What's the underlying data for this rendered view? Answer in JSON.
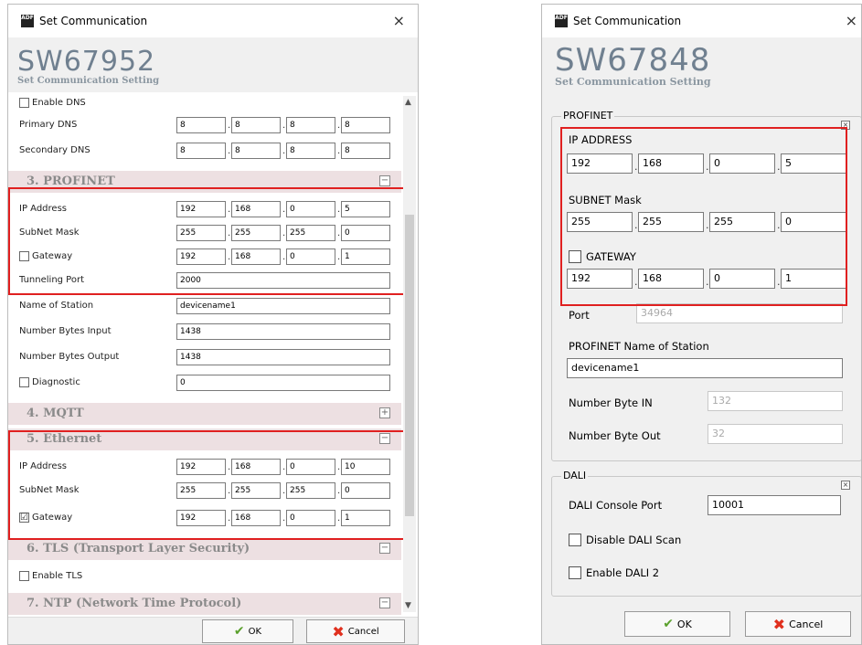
{
  "left": {
    "title": "Set Communication",
    "close": "×",
    "product": "SW67952",
    "subtitle": "Set Communication Setting",
    "dns": {
      "enable_label": "Enable DNS",
      "primary_label": "Primary DNS",
      "primary": [
        "8",
        "8",
        "8",
        "8"
      ],
      "secondary_label": "Secondary DNS",
      "secondary": [
        "8",
        "8",
        "8",
        "8"
      ]
    },
    "profinet": {
      "header": "3. PROFINET",
      "toggle": "⊟",
      "ip_label": "IP Address",
      "ip": [
        "192",
        "168",
        "0",
        "5"
      ],
      "mask_label": "SubNet Mask",
      "mask": [
        "255",
        "255",
        "255",
        "0"
      ],
      "gw_label": "Gateway",
      "gw": [
        "192",
        "168",
        "0",
        "1"
      ],
      "tunnel_label": "Tunneling Port",
      "tunnel": "2000",
      "station_label": "Name of Station",
      "station": "devicename1",
      "bin_label": "Number Bytes Input",
      "bin": "1438",
      "bout_label": "Number Bytes Output",
      "bout": "1438",
      "diag_label": "Diagnostic",
      "diag": "0"
    },
    "mqtt": {
      "header": "4. MQTT",
      "toggle": "⊞"
    },
    "ethernet": {
      "header": "5. Ethernet",
      "toggle": "⊟",
      "ip_label": "IP Address",
      "ip": [
        "192",
        "168",
        "0",
        "10"
      ],
      "mask_label": "SubNet Mask",
      "mask": [
        "255",
        "255",
        "255",
        "0"
      ],
      "gw_label": "Gateway",
      "gw_checked": "☑",
      "gw": [
        "192",
        "168",
        "0",
        "1"
      ]
    },
    "tls": {
      "header": "6. TLS (Transport Layer Security)",
      "toggle": "⊟",
      "enable_label": "Enable TLS"
    },
    "ntp": {
      "header": "7. NTP (Network Time Protocol)",
      "toggle": "⊟"
    },
    "ok": "OK",
    "cancel": "Cancel"
  },
  "right": {
    "title": "Set Communication",
    "close": "×",
    "product": "SW67848",
    "subtitle": "Set Communication Setting",
    "profinet": {
      "legend": "PROFINET",
      "ip_label": "IP ADDRESS",
      "ip": [
        "192",
        "168",
        "0",
        "5"
      ],
      "mask_label": "SUBNET Mask",
      "mask": [
        "255",
        "255",
        "255",
        "0"
      ],
      "gw_label": "GATEWAY",
      "gw": [
        "192",
        "168",
        "0",
        "1"
      ],
      "port_label": "Port",
      "port": "34964",
      "station_label": "PROFINET Name of Station",
      "station": "devicename1",
      "bin_label": "Number Byte IN",
      "bin": "132",
      "bout_label": "Number Byte Out",
      "bout": "32"
    },
    "dali": {
      "legend": "DALI",
      "console_label": "DALI Console Port",
      "console": "10001",
      "disable_scan_label": "Disable DALI Scan",
      "enable2_label": "Enable DALI 2"
    },
    "ok": "OK",
    "cancel": "Cancel"
  },
  "colors": {
    "highlight": "#e02020",
    "section_bg": "#ede0e2",
    "header_text": "#708090"
  }
}
